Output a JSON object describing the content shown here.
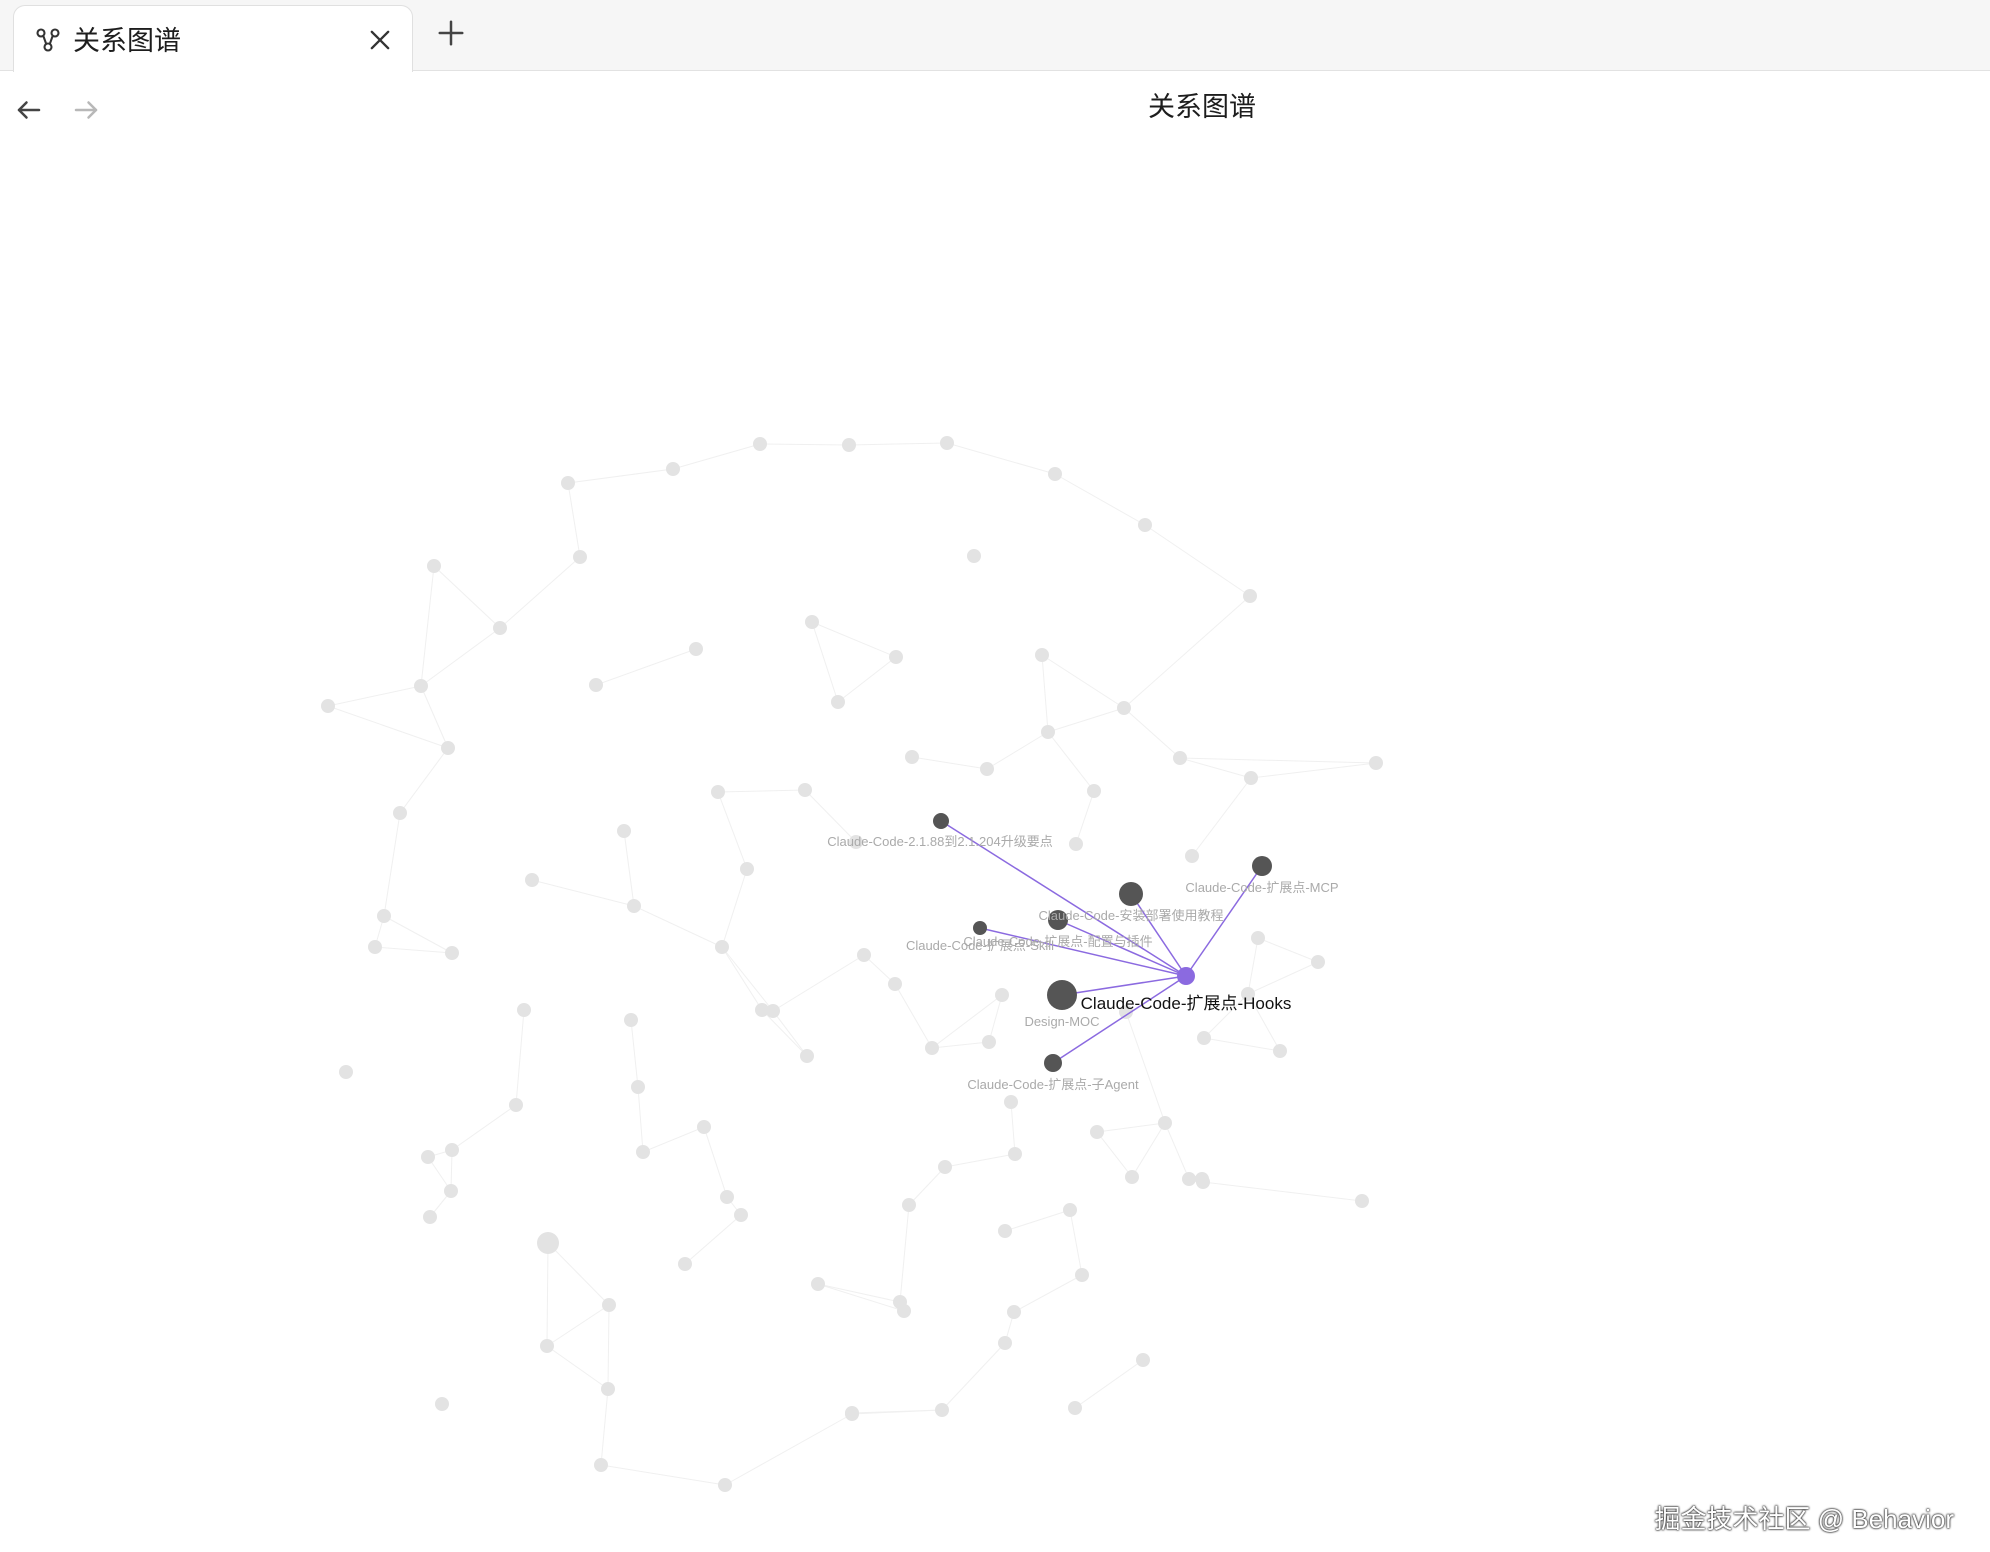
{
  "tab": {
    "title": "关系图谱",
    "icon": "graph-icon"
  },
  "view": {
    "title": "关系图谱"
  },
  "graph": {
    "highlight_color": "#8b6ae0",
    "neighbor_color": "#555555",
    "faded_color": "#e3e3e3",
    "center_label": "Claude-Code-扩展点-Hooks",
    "neighbor_labels": [
      "Claude-Code-2.1.88到2.1.204升级要点",
      "Claude-Code-扩展点-MCP",
      "Claude-Code-安装部署使用教程",
      "Claude-Code-扩展点-配置与插件",
      "Claude-Code-扩展点-Skill",
      "Design-MOC",
      "Claude-Code-扩展点-子Agent"
    ]
  },
  "watermark": "掘金技术社区 @ Behavior"
}
